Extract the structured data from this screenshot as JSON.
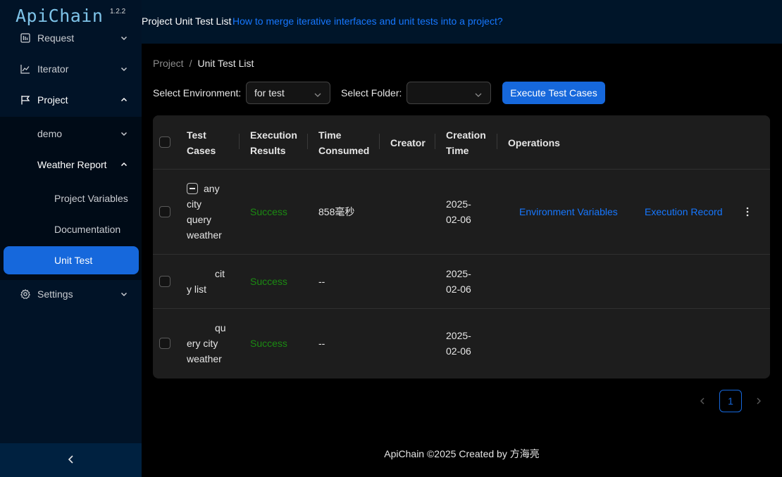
{
  "app": {
    "name": "ApiChain",
    "version": "1.2.2"
  },
  "sidebar": {
    "items": [
      {
        "label": "Request",
        "icon": "request-icon"
      },
      {
        "label": "Iterator",
        "icon": "chart-line-icon"
      },
      {
        "label": "Project",
        "icon": "flag-icon"
      },
      {
        "label": "demo"
      },
      {
        "label": "Weather Report"
      },
      {
        "label": "Project Variables"
      },
      {
        "label": "Documentation"
      },
      {
        "label": "Unit Test"
      },
      {
        "label": "Settings",
        "icon": "gear-icon"
      }
    ],
    "collapse_icon": "chevron-left-icon"
  },
  "header": {
    "title": "Project Unit Test List",
    "help_link": "How to merge iterative interfaces and unit tests into a project?"
  },
  "breadcrumb": {
    "root": "Project",
    "separator": "/",
    "current": "Unit Test List"
  },
  "filters": {
    "environment_label": "Select Environment:",
    "environment_value": "for test",
    "folder_label": "Select Folder:",
    "folder_value": "",
    "execute_button": "Execute Test Cases"
  },
  "table": {
    "columns": [
      {
        "line1": "Test",
        "line2": "Cases"
      },
      {
        "line1": "Execution",
        "line2": "Results"
      },
      {
        "line1": "Time",
        "line2": "Consumed"
      },
      {
        "line1": "Creator",
        "line2": ""
      },
      {
        "line1": "Creation",
        "line2": "Time"
      },
      {
        "line1": "Operations",
        "line2": ""
      }
    ],
    "rows": [
      {
        "case_lines": [
          "any",
          "city",
          "query",
          "weather"
        ],
        "result": "Success",
        "time_consumed": "858毫秒",
        "creator": "",
        "date_lines": [
          "2025-",
          "02-06"
        ],
        "op_env": "Environment Variables",
        "op_record": "Execution Record"
      },
      {
        "case_lines": [
          "cit",
          "y list"
        ],
        "result": "Success",
        "time_consumed": "--",
        "creator": "",
        "date_lines": [
          "2025-",
          "02-06"
        ]
      },
      {
        "case_lines": [
          "qu",
          "ery city",
          "weather"
        ],
        "result": "Success",
        "time_consumed": "--",
        "creator": "",
        "date_lines": [
          "2025-",
          "02-06"
        ]
      }
    ]
  },
  "pagination": {
    "current": "1"
  },
  "footer": "ApiChain ©2025 Created by 方海亮",
  "colors": {
    "primary": "#1668dc",
    "success": "#1b8a12",
    "sidebar": "#011327",
    "header": "#001529"
  }
}
